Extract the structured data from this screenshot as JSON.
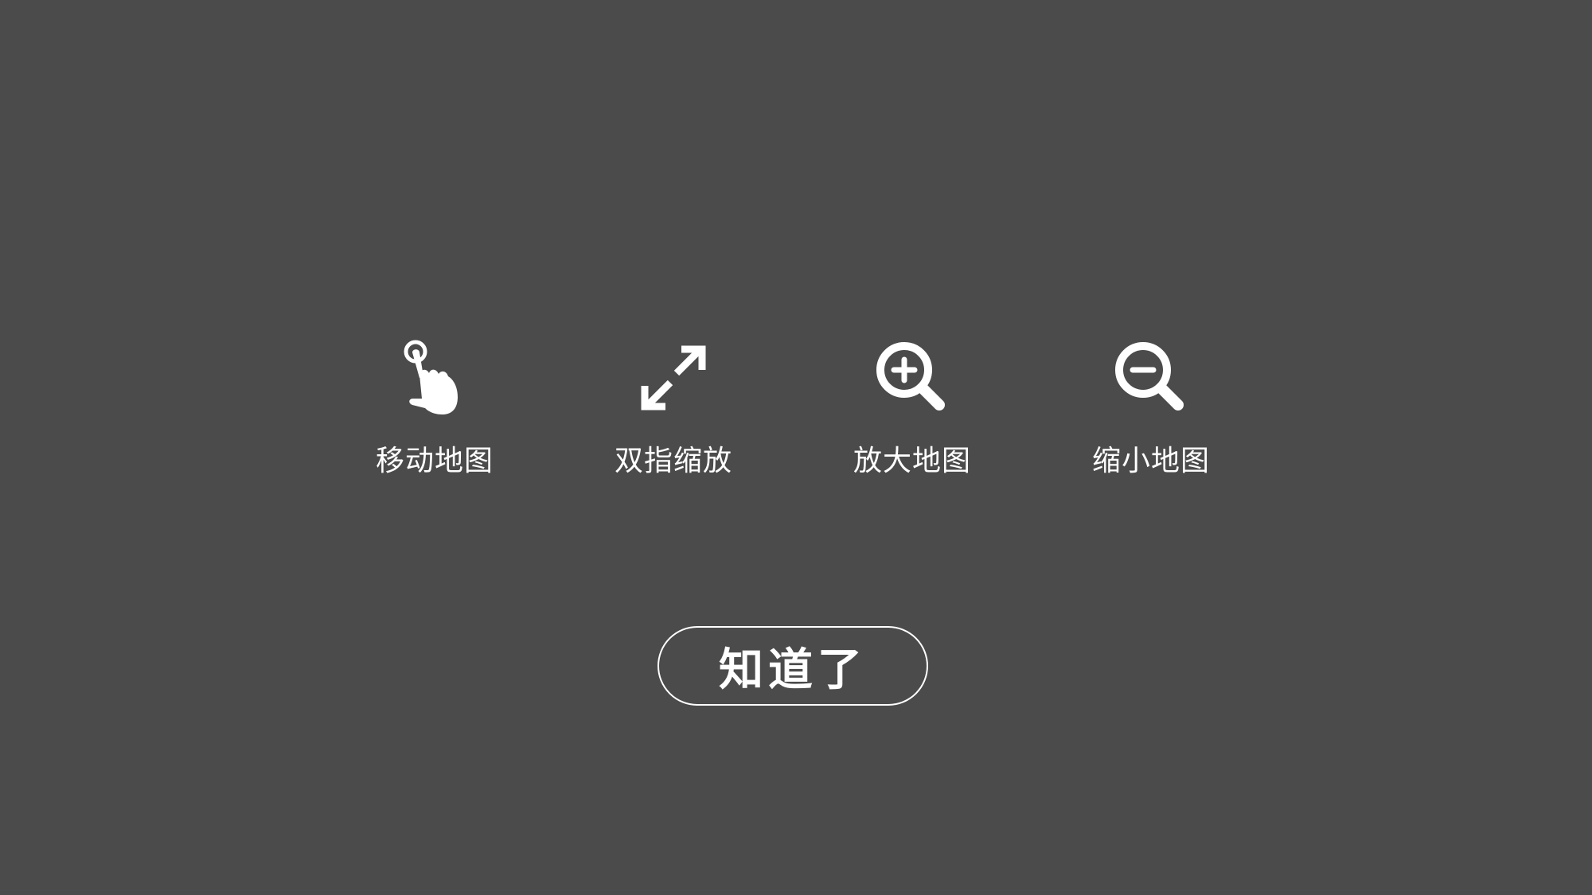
{
  "gestures": [
    {
      "icon": "tap-hand-icon",
      "label": "移动地图"
    },
    {
      "icon": "pinch-expand-icon",
      "label": "双指缩放"
    },
    {
      "icon": "zoom-in-icon",
      "label": "放大地图"
    },
    {
      "icon": "zoom-out-icon",
      "label": "缩小地图"
    }
  ],
  "confirm_button": {
    "label": "知道了"
  },
  "colors": {
    "background": "#4b4b4b",
    "foreground": "#ffffff"
  }
}
